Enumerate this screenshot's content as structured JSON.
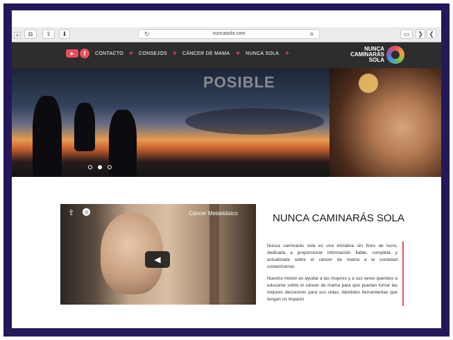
{
  "browser": {
    "url": "nuncasola.com",
    "reload_icon": "reload-icon",
    "reader_icon": "reader-icon",
    "new_tab_label": "+"
  },
  "nav": {
    "menu": [
      {
        "label": "NUNCA SOLA"
      },
      {
        "label": "CÁNCER DE MAMA"
      },
      {
        "label": "CONSEJOS"
      },
      {
        "label": "CONTACTO"
      }
    ],
    "plus_glyph": "+",
    "logo_lines": [
      "NUNCA",
      "CAMINARÁS",
      "SOLA"
    ],
    "accent": "#e94e5b"
  },
  "hero": {
    "overlay_text": "POSIBLE"
  },
  "video": {
    "title": "Cáncer Metastásico"
  },
  "article": {
    "title": "NUNCA CAMINARÁS SOLA",
    "paragraph_1": "Nunca caminarás sola es una iniciativa sin fines de lucro, dedicada a proporcionar información fiable, completa y actualizada sobre el cáncer de mama a la sociedad costarricense.",
    "paragraph_2": "Nuestra misión es ayudar a las mujeres y a sus seres queridos a educarse sobre el cáncer de mama para que puedan tomar las mejores decisiones para sus vidas, dándoles herramientas que tengan un impacto"
  },
  "colors": {
    "frame": "#23185a",
    "nav_bg": "#2d2d2d"
  }
}
